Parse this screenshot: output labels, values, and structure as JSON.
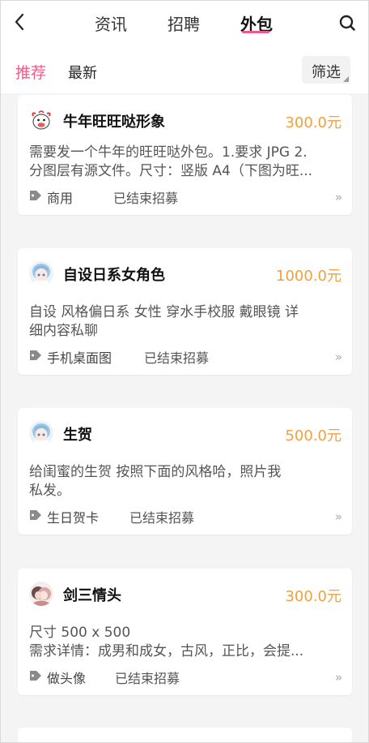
{
  "header": {
    "tabs": [
      "资讯",
      "招聘",
      "外包"
    ],
    "active_tab": "外包"
  },
  "subnav": {
    "recommended": "推荐",
    "latest": "最新",
    "filter": "筛选"
  },
  "cards": [
    {
      "title": "牛年旺旺哒形象",
      "price": "300.0元",
      "desc_line1": "需要发一个牛年的旺旺哒外包。1.要求 JPG  2.",
      "desc_line2": "分图层有源文件。尺寸：竖版 A4（下图为旺...",
      "tag": "商用",
      "status": "已结束招募",
      "arrow": "»"
    },
    {
      "title": "自设日系女角色",
      "price": "1000.0元",
      "desc_line1": "自设 风格偏日系 女性 穿水手校服 戴眼镜  详",
      "desc_line2": "细内容私聊",
      "tag": "手机桌面图",
      "status": "已结束招募",
      "arrow": "»"
    },
    {
      "title": "生贺",
      "price": "500.0元",
      "desc_line1": "给闺蜜的生贺 按照下面的风格哈，照片我",
      "desc_line2": "私发。",
      "tag": "生日贺卡",
      "status": "已结束招募",
      "arrow": "»"
    },
    {
      "title": "剑三情头",
      "price": "300.0元",
      "desc_line1": "尺寸 500 x 500",
      "desc_line2": "需求详情：成男和成女，古风，正比，会提...",
      "tag": "做头像",
      "status": "已结束招募",
      "arrow": "»"
    }
  ],
  "colors": {
    "accent_pink": "#ef5a8a",
    "price_orange": "#f2a03a"
  }
}
